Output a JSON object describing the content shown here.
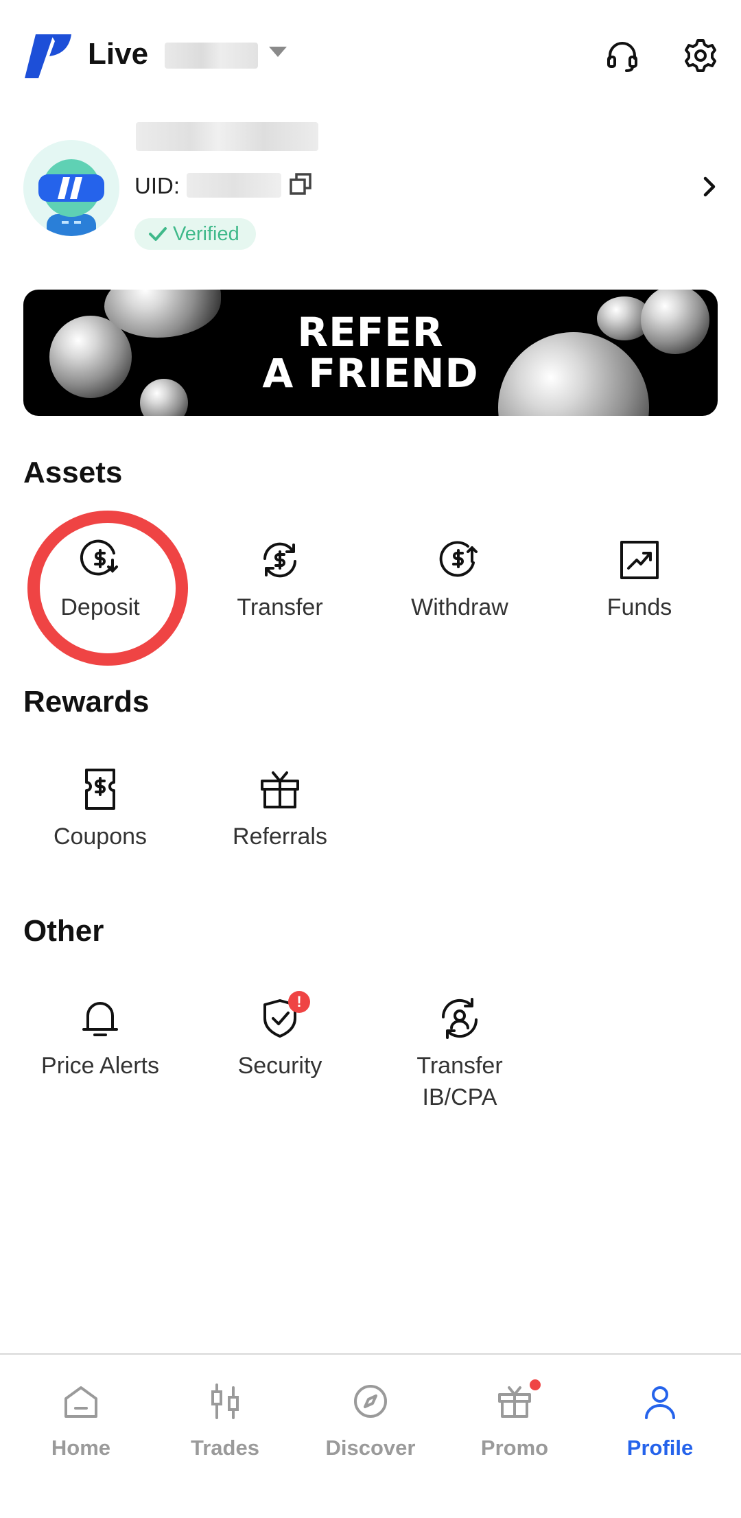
{
  "header": {
    "account_type": "Live",
    "icons": [
      "support-headset-icon",
      "settings-gear-icon"
    ]
  },
  "profile": {
    "uid_label": "UID:",
    "verified_label": "Verified"
  },
  "banner": {
    "line1": "REFER",
    "line2": "A FRIEND"
  },
  "sections": {
    "assets": {
      "title": "Assets",
      "items": [
        {
          "label": "Deposit",
          "icon": "deposit-icon"
        },
        {
          "label": "Transfer",
          "icon": "transfer-icon"
        },
        {
          "label": "Withdraw",
          "icon": "withdraw-icon"
        },
        {
          "label": "Funds",
          "icon": "funds-chart-icon"
        }
      ]
    },
    "rewards": {
      "title": "Rewards",
      "items": [
        {
          "label": "Coupons",
          "icon": "coupon-icon"
        },
        {
          "label": "Referrals",
          "icon": "gift-icon"
        }
      ]
    },
    "other": {
      "title": "Other",
      "items": [
        {
          "label": "Price Alerts",
          "icon": "bell-icon"
        },
        {
          "label": "Security",
          "icon": "shield-icon",
          "badge": "!"
        },
        {
          "label": "Transfer IB/CPA",
          "icon": "user-transfer-icon"
        }
      ]
    }
  },
  "bottom_nav": {
    "items": [
      {
        "label": "Home",
        "icon": "home-icon"
      },
      {
        "label": "Trades",
        "icon": "candlestick-icon"
      },
      {
        "label": "Discover",
        "icon": "compass-icon"
      },
      {
        "label": "Promo",
        "icon": "gift-icon"
      },
      {
        "label": "Profile",
        "icon": "user-icon",
        "active": true
      }
    ]
  },
  "colors": {
    "accent": "#2563eb",
    "verified": "#3fb98a",
    "highlight": "#ef4444",
    "logo": "#1d4fd8"
  }
}
